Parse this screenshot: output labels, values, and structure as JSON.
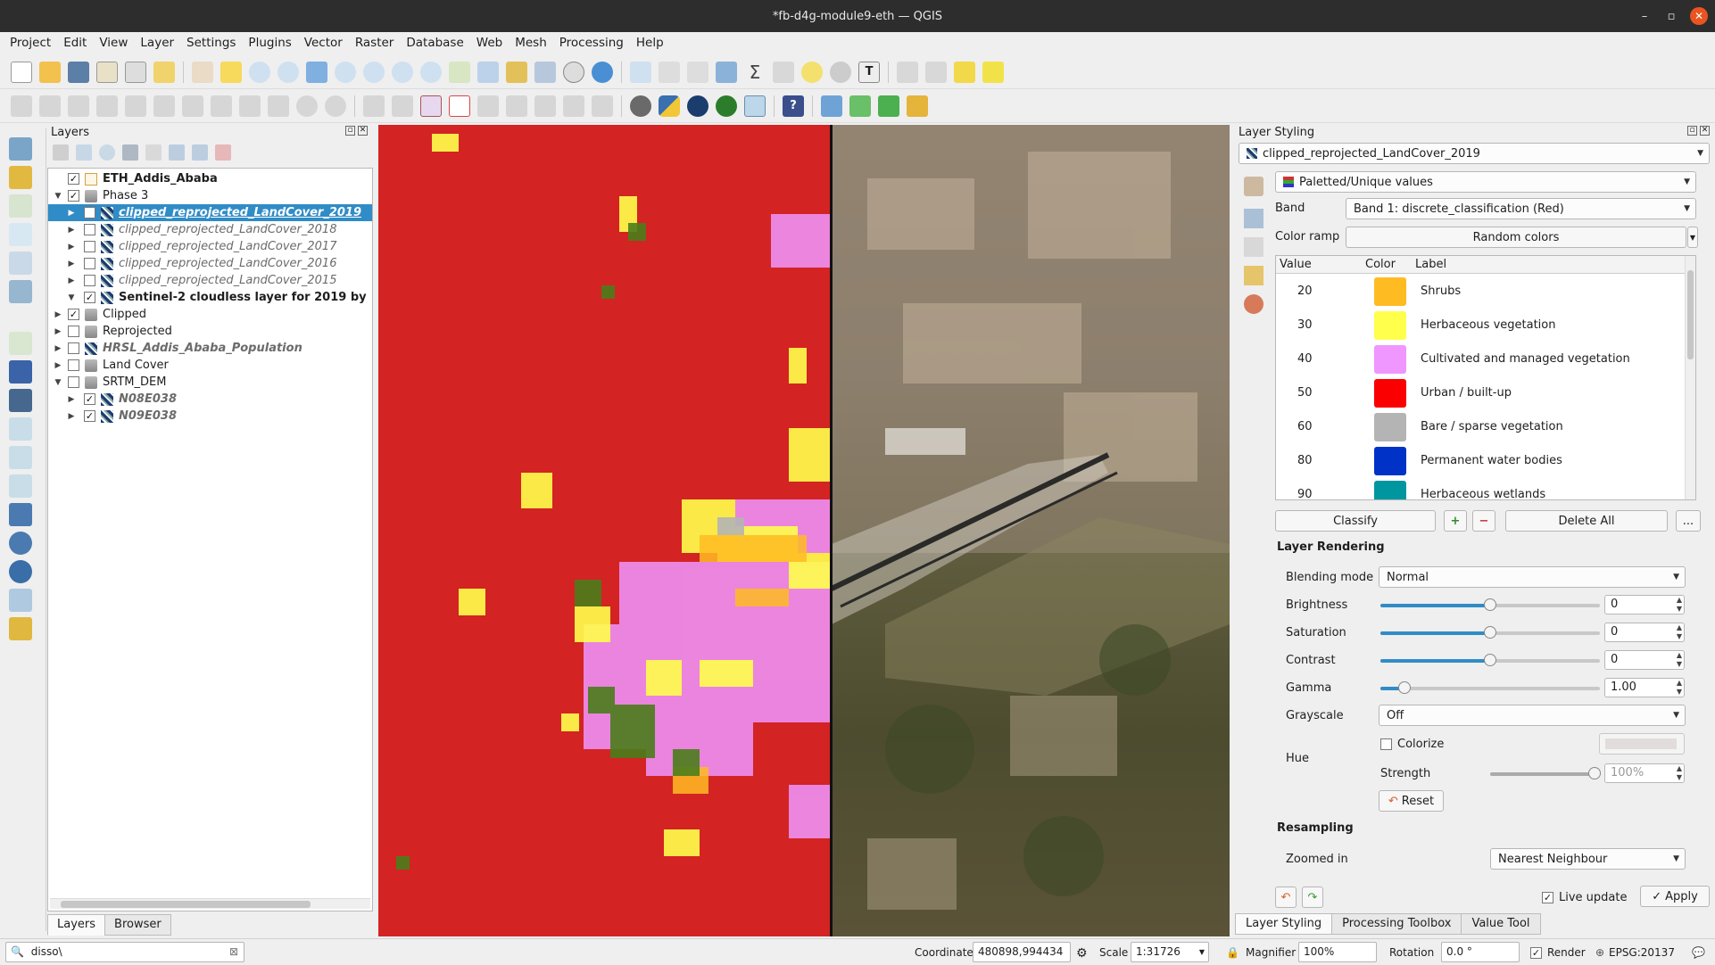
{
  "window": {
    "title": "*fb-d4g-module9-eth — QGIS"
  },
  "menu": [
    "Project",
    "Edit",
    "View",
    "Layer",
    "Settings",
    "Plugins",
    "Vector",
    "Raster",
    "Database",
    "Web",
    "Mesh",
    "Processing",
    "Help"
  ],
  "layers_panel": {
    "title": "Layers",
    "items": [
      {
        "label": "ETH_Addis_Ababa",
        "style": "bold",
        "checked": true
      },
      {
        "label": "Phase 3",
        "checked": true
      },
      {
        "label": "clipped_reprojected_LandCover_2019",
        "selected": true,
        "checked": false
      },
      {
        "label": "clipped_reprojected_LandCover_2018",
        "checked": false
      },
      {
        "label": "clipped_reprojected_LandCover_2017",
        "checked": false
      },
      {
        "label": "clipped_reprojected_LandCover_2016",
        "checked": false
      },
      {
        "label": "clipped_reprojected_LandCover_2015",
        "checked": false
      },
      {
        "label": "Sentinel-2 cloudless layer for 2019 by",
        "style": "bold",
        "checked": true
      },
      {
        "label": "Clipped",
        "checked": true
      },
      {
        "label": "Reprojected",
        "checked": false
      },
      {
        "label": "HRSL_Addis_Ababa_Population",
        "checked": false
      },
      {
        "label": "Land Cover",
        "checked": false
      },
      {
        "label": "SRTM_DEM",
        "checked": false
      },
      {
        "label": "N08E038",
        "checked": true
      },
      {
        "label": "N09E038",
        "checked": true
      }
    ],
    "tabs": [
      "Layers",
      "Browser"
    ]
  },
  "styling": {
    "title": "Layer Styling",
    "layer": "clipped_reprojected_LandCover_2019",
    "renderer": "Paletted/Unique values",
    "band_label": "Band",
    "band": "Band 1: discrete_classification (Red)",
    "color_ramp_label": "Color ramp",
    "color_ramp": "Random colors",
    "table_headers": [
      "Value",
      "Color",
      "Label"
    ],
    "classes": [
      {
        "value": "20",
        "color": "#ffbb22",
        "label": "Shrubs"
      },
      {
        "value": "30",
        "color": "#ffff4c",
        "label": "Herbaceous vegetation"
      },
      {
        "value": "40",
        "color": "#f096ff",
        "label": "Cultivated and managed vegetation"
      },
      {
        "value": "50",
        "color": "#fa0000",
        "label": "Urban / built-up"
      },
      {
        "value": "60",
        "color": "#b4b4b4",
        "label": "Bare / sparse vegetation"
      },
      {
        "value": "80",
        "color": "#0032c8",
        "label": "Permanent water bodies"
      },
      {
        "value": "90",
        "color": "#0096a0",
        "label": "Herbaceous wetlands"
      }
    ],
    "classify": "Classify",
    "delete_all": "Delete All",
    "more": "...",
    "rendering_title": "Layer Rendering",
    "blending_label": "Blending mode",
    "blending": "Normal",
    "brightness_label": "Brightness",
    "brightness": "0",
    "saturation_label": "Saturation",
    "saturation": "0",
    "contrast_label": "Contrast",
    "contrast": "0",
    "gamma_label": "Gamma",
    "gamma": "1.00",
    "grayscale_label": "Grayscale",
    "grayscale": "Off",
    "hue_label": "Hue",
    "colorize": "Colorize",
    "strength_label": "Strength",
    "strength": "100%",
    "reset": "Reset",
    "resampling_title": "Resampling",
    "zoomed_in_label": "Zoomed in",
    "zoomed_in": "Nearest Neighbour",
    "live_update": "Live update",
    "apply": "Apply",
    "tabs": [
      "Layer Styling",
      "Processing Toolbox",
      "Value Tool"
    ]
  },
  "statusbar": {
    "search": "disso\\",
    "coordinate_label": "Coordinate",
    "coordinate": "480898,994434",
    "scale_label": "Scale",
    "scale": "1:31726",
    "magnifier_label": "Magnifier",
    "magnifier": "100%",
    "rotation_label": "Rotation",
    "rotation": "0.0 °",
    "render": "Render",
    "crs": "EPSG:20137"
  },
  "colors": {
    "selection": "#308cc6",
    "close_button": "#e95420",
    "urban": "#d32323"
  }
}
